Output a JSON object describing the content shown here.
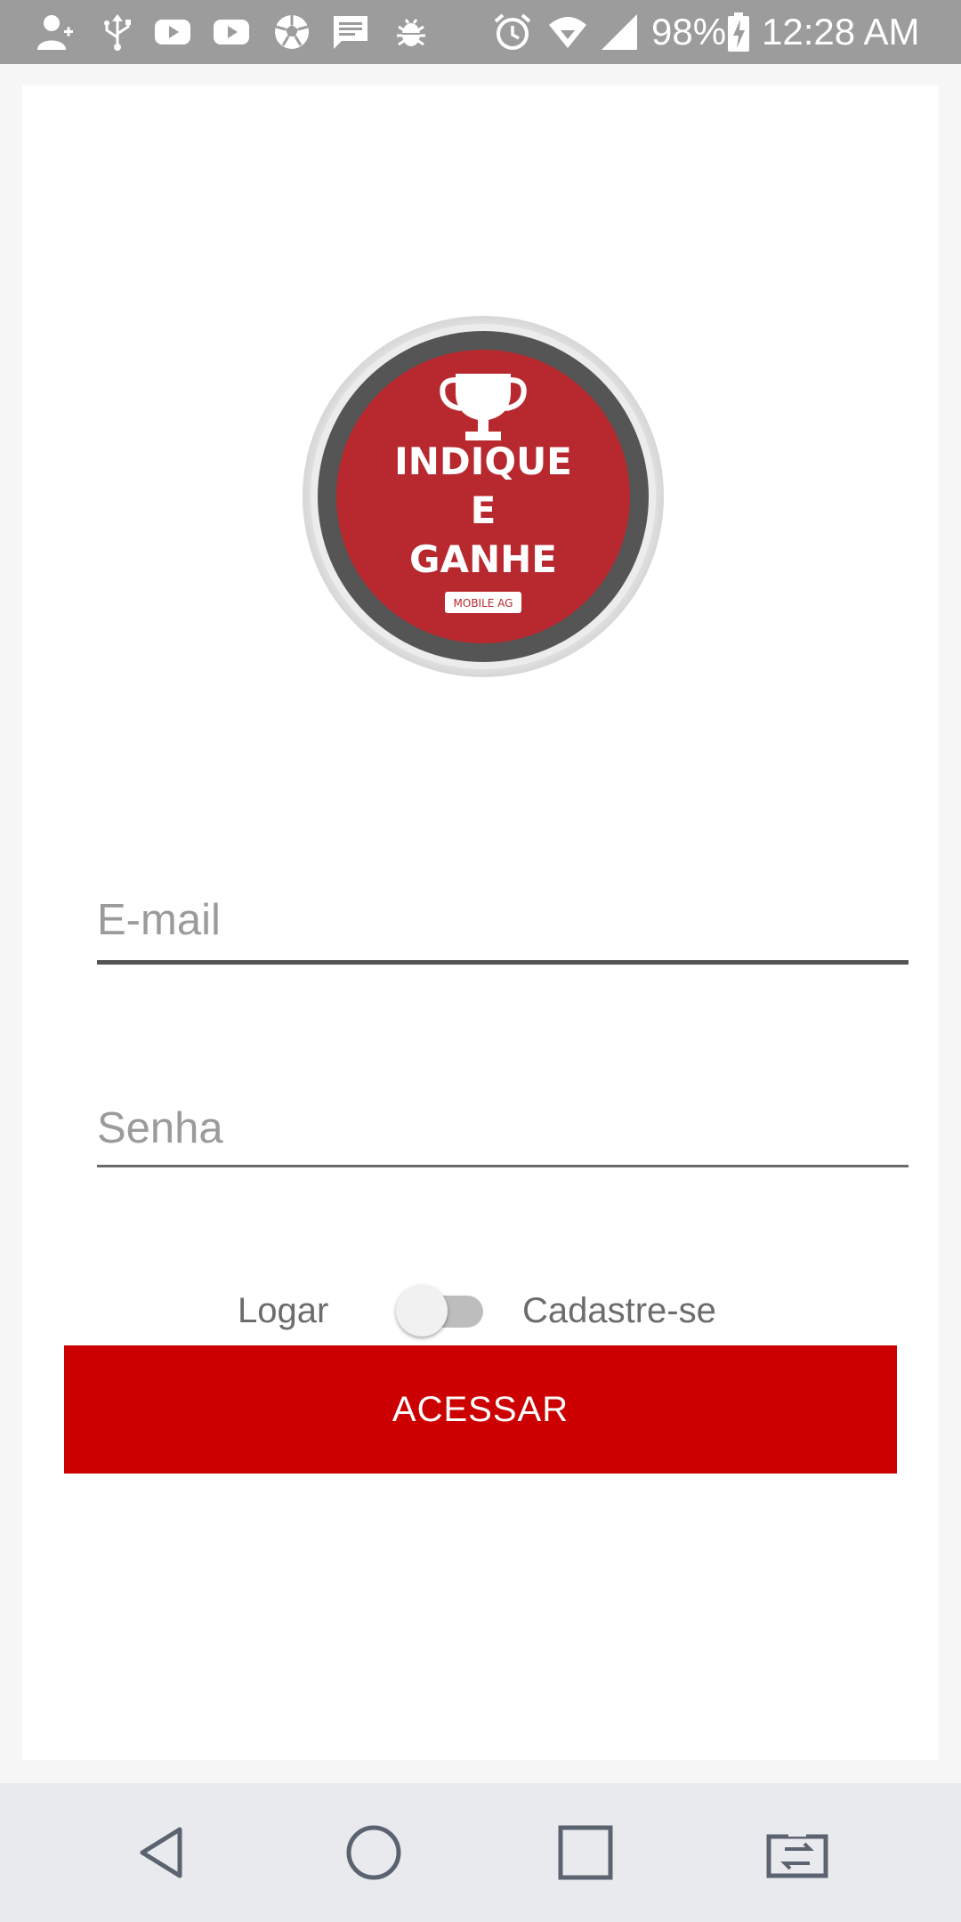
{
  "status_bar": {
    "battery": "98%",
    "time": "12:28 AM",
    "icons": [
      "add-contact-icon",
      "usb-icon",
      "youtube-icon",
      "youtube-icon",
      "soccer-ball-icon",
      "message-icon",
      "bug-icon",
      "alarm-icon",
      "wifi-icon",
      "signal-icon",
      "battery-charging-icon"
    ]
  },
  "logo": {
    "line1": "INDIQUE",
    "line2": "E",
    "line3": "GANHE",
    "tag": "MOBILE AG",
    "icon": "trophy-icon",
    "colors": {
      "ring_outer": "#e6e6e6",
      "ring_dark": "#555555",
      "disc": "#b8292f"
    }
  },
  "form": {
    "email_placeholder": "E-mail",
    "password_placeholder": "Senha",
    "toggle_left_label": "Logar",
    "toggle_right_label": "Cadastre-se",
    "toggle_on": false,
    "submit_label": "ACESSAR"
  },
  "colors": {
    "accent": "#cc0000",
    "status_bar": "#9c9c9c",
    "nav_bar": "#e9eaed"
  },
  "nav_bar": {
    "icons": [
      "back-icon",
      "home-icon",
      "recents-icon",
      "switch-app-icon"
    ]
  }
}
